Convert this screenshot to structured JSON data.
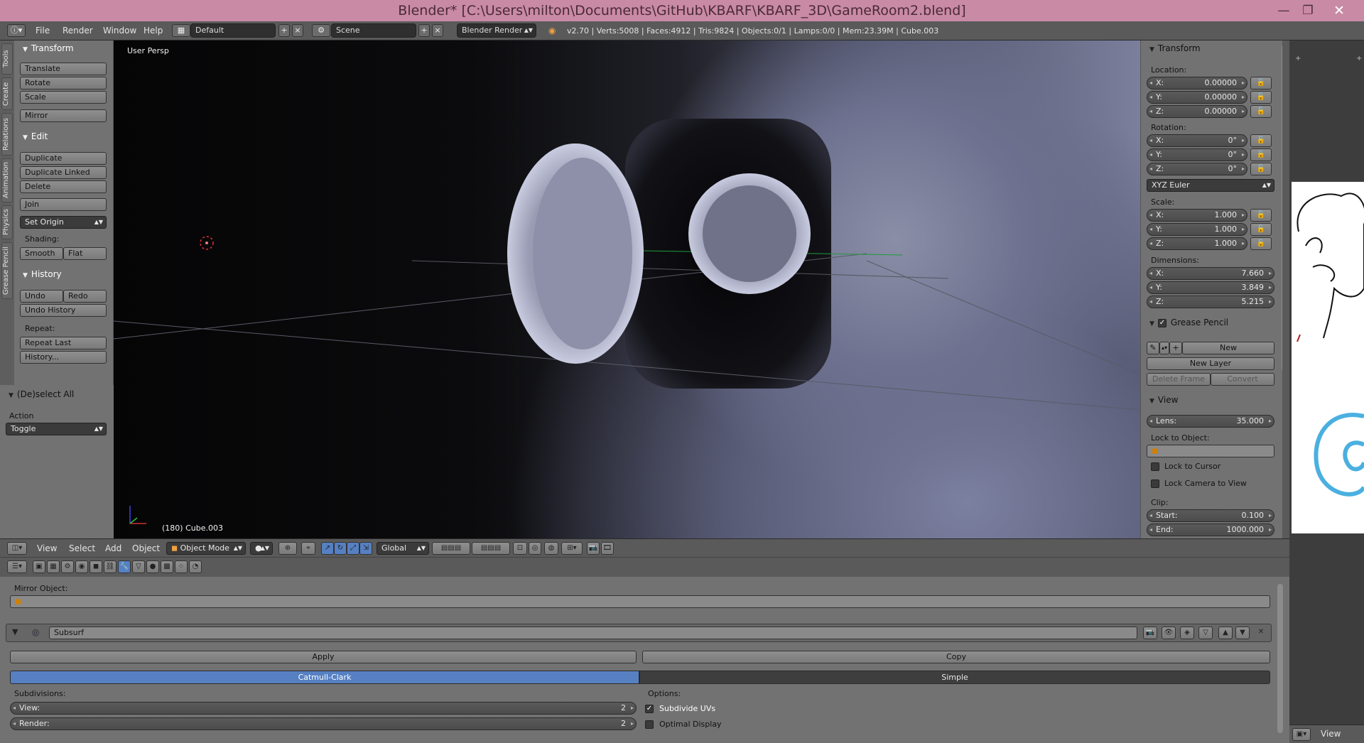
{
  "window": {
    "title": "Blender* [C:\\Users\\milton\\Documents\\GitHub\\KBARF\\KBARF_3D\\GameRoom2.blend]",
    "min": "—",
    "max": "❐",
    "close": "✕"
  },
  "info": {
    "menus": [
      "File",
      "Render",
      "Window",
      "Help"
    ],
    "layout": "Default",
    "scene": "Scene",
    "engine": "Blender Render",
    "stats": "v2.70 | Verts:5008 | Faces:4912 | Tris:9824 | Objects:0/1 | Lamps:0/0 | Mem:23.39M | Cube.003"
  },
  "sidetabs": [
    "Tools",
    "Create",
    "Relations",
    "Animation",
    "Physics",
    "Grease Pencil"
  ],
  "tools": {
    "transform_header": "Transform",
    "translate": "Translate",
    "rotate": "Rotate",
    "scale": "Scale",
    "mirror": "Mirror",
    "edit_header": "Edit",
    "duplicate": "Duplicate",
    "duplicate_linked": "Duplicate Linked",
    "delete": "Delete",
    "join": "Join",
    "set_origin": "Set Origin",
    "shading_label": "Shading:",
    "smooth": "Smooth",
    "flat": "Flat",
    "history_header": "History",
    "undo": "Undo",
    "redo": "Redo",
    "undo_history": "Undo History",
    "repeat_label": "Repeat:",
    "repeat_last": "Repeat Last",
    "history": "History..."
  },
  "operator": {
    "header": "(De)select All",
    "action_label": "Action",
    "action_value": "Toggle"
  },
  "viewport": {
    "persp": "User Persp",
    "object_info": "(180) Cube.003"
  },
  "npanel": {
    "transform_header": "Transform",
    "location_label": "Location:",
    "location": [
      {
        "axis": "X:",
        "value": "0.00000"
      },
      {
        "axis": "Y:",
        "value": "0.00000"
      },
      {
        "axis": "Z:",
        "value": "0.00000"
      }
    ],
    "rotation_label": "Rotation:",
    "rotation": [
      {
        "axis": "X:",
        "value": "0°"
      },
      {
        "axis": "Y:",
        "value": "0°"
      },
      {
        "axis": "Z:",
        "value": "0°"
      }
    ],
    "rotation_mode": "XYZ Euler",
    "scale_label": "Scale:",
    "scale": [
      {
        "axis": "X:",
        "value": "1.000"
      },
      {
        "axis": "Y:",
        "value": "1.000"
      },
      {
        "axis": "Z:",
        "value": "1.000"
      }
    ],
    "dimensions_label": "Dimensions:",
    "dimensions": [
      {
        "axis": "X:",
        "value": "7.660"
      },
      {
        "axis": "Y:",
        "value": "3.849"
      },
      {
        "axis": "Z:",
        "value": "5.215"
      }
    ],
    "grease_header": "Grease Pencil",
    "gp_new": "New",
    "gp_new_layer": "New Layer",
    "gp_delete_frame": "Delete Frame",
    "gp_convert": "Convert",
    "view_header": "View",
    "lens_label": "Lens:",
    "lens_value": "35.000",
    "lock_object_label": "Lock to Object:",
    "lock_cursor": "Lock to Cursor",
    "lock_camera": "Lock Camera to View",
    "clip_label": "Clip:",
    "clip_start_label": "Start:",
    "clip_start": "0.100",
    "clip_end_label": "End:",
    "clip_end": "1000.000"
  },
  "vheader": {
    "menus": [
      "View",
      "Select",
      "Add",
      "Object"
    ],
    "mode": "Object Mode",
    "orientation": "Global"
  },
  "props": {
    "mirror_object_label": "Mirror Object:",
    "modifier_name": "Subsurf",
    "apply": "Apply",
    "copy": "Copy",
    "catmull": "Catmull-Clark",
    "simple": "Simple",
    "subdivisions_label": "Subdivisions:",
    "view_label": "View:",
    "view_value": "2",
    "render_label": "Render:",
    "render_value": "2",
    "options_label": "Options:",
    "subdivide_uvs": "Subdivide UVs",
    "optimal_display": "Optimal Display"
  },
  "image_editor": {
    "view_menu": "View"
  },
  "colors": {
    "accent": "#5680c2",
    "titlebar": "#c98aa5",
    "panel": "#727272"
  }
}
